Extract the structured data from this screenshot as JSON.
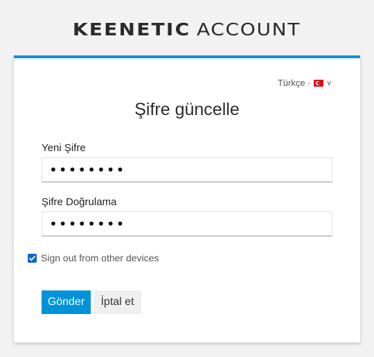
{
  "header": {
    "brand": "KEENETIC",
    "product": "ACCOUNT"
  },
  "language": {
    "label": "Türkçe ·",
    "flag_icon": "turkey-flag-icon",
    "chevron": "v"
  },
  "form": {
    "title": "Şifre güncelle",
    "new_password_label": "Yeni Şifre",
    "new_password_value": "••••••••",
    "confirm_password_label": "Şifre Doğrulama",
    "confirm_password_value": "••••••••",
    "signout_label": "Sign out from other devices",
    "signout_checked": true,
    "submit_label": "Gönder",
    "cancel_label": "İptal et"
  },
  "colors": {
    "accent": "#0093d9",
    "checkbox": "#0a66d8",
    "background": "#f2f2f2"
  }
}
